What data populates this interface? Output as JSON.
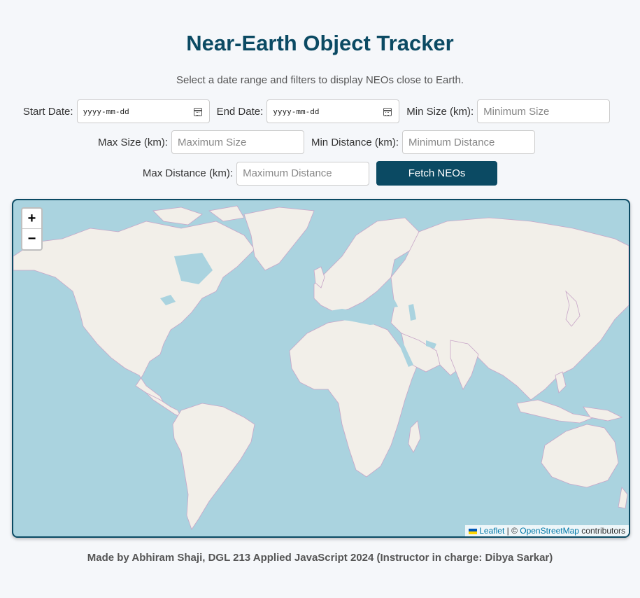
{
  "header": {
    "title": "Near-Earth Object Tracker",
    "subtitle": "Select a date range and filters to display NEOs close to Earth."
  },
  "filters": {
    "start_date_label": "Start Date:",
    "start_date_placeholder": "yyyy-mm-dd",
    "end_date_label": "End Date:",
    "end_date_placeholder": "yyyy-mm-dd",
    "min_size_label": "Min Size (km):",
    "min_size_placeholder": "Minimum Size",
    "max_size_label": "Max Size (km):",
    "max_size_placeholder": "Maximum Size",
    "min_distance_label": "Min Distance (km):",
    "min_distance_placeholder": "Minimum Distance",
    "max_distance_label": "Max Distance (km):",
    "max_distance_placeholder": "Maximum Distance",
    "fetch_button": "Fetch NEOs"
  },
  "map": {
    "zoom_in": "+",
    "zoom_out": "−",
    "attribution_leaflet": "Leaflet",
    "attribution_sep": " | © ",
    "attribution_osm": "OpenStreetMap",
    "attribution_contributors": " contributors",
    "colors": {
      "water": "#aad3df",
      "land": "#f2efe9",
      "border": "#c8a6c8"
    }
  },
  "footer": {
    "text": "Made by Abhiram Shaji, DGL 213 Applied JavaScript 2024 (Instructor in charge: Dibya Sarkar)"
  }
}
